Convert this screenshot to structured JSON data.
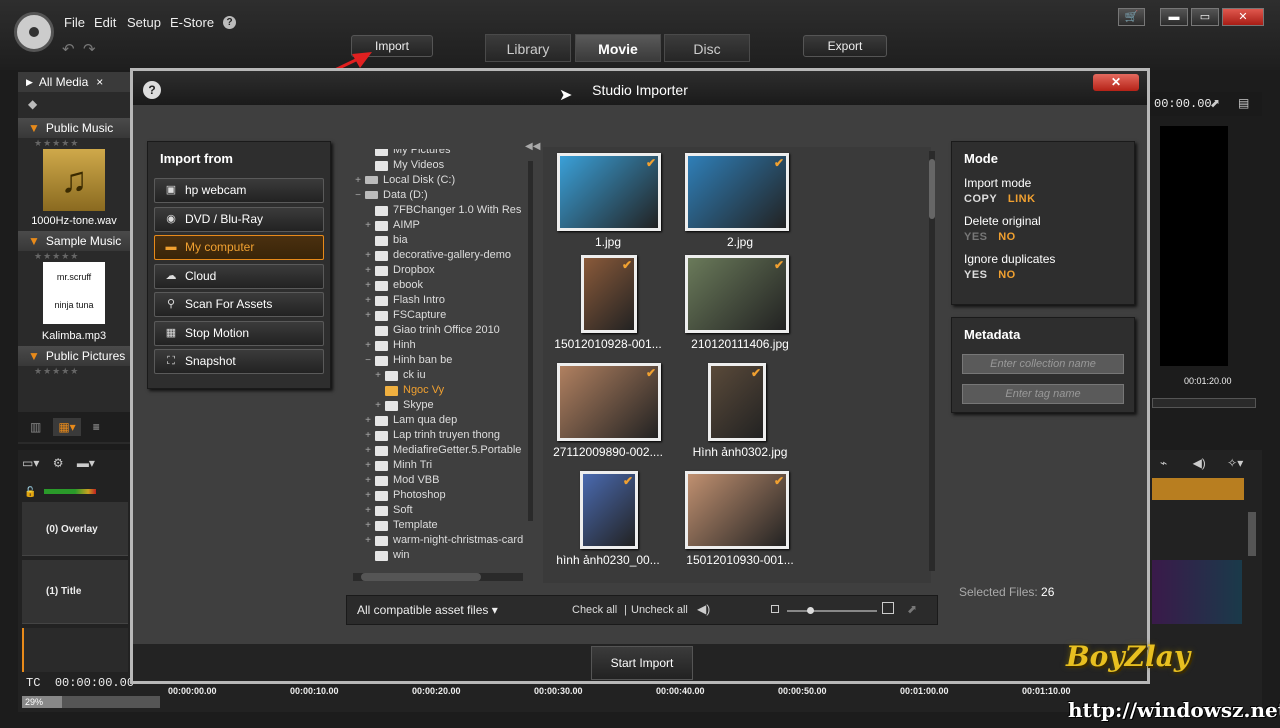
{
  "app": {
    "menu": [
      "File",
      "Edit",
      "Setup",
      "E-Store",
      "?"
    ],
    "import_label": "Import",
    "export_label": "Export",
    "tabs": [
      {
        "label": "Library",
        "active": false
      },
      {
        "label": "Movie",
        "active": true
      },
      {
        "label": "Disc",
        "active": false
      }
    ],
    "window_buttons": {
      "min": "▬",
      "max": "▭",
      "close": "✕",
      "cart": "🛒"
    }
  },
  "library": {
    "tab_label": "All Media",
    "tab_close": "×",
    "sections": [
      {
        "title": "Public Music",
        "item": "1000Hz-tone.wav"
      },
      {
        "title": "Sample Music",
        "item": "Kalimba.mp3",
        "art_lines": [
          "mr.scruff",
          "ninja tuna"
        ]
      },
      {
        "title": "Public Pictures",
        "item": ""
      }
    ]
  },
  "player": {
    "timecode": "00:00.00",
    "scrub_time": "00:01:20.00"
  },
  "timeline": {
    "tracks": [
      "(0) Overlay",
      "(1) Title"
    ],
    "tc_label": "TC",
    "tc_value": "00:00:00.00",
    "zoom": "29%",
    "ruler": [
      "00:00:00.00",
      "00:00:10.00",
      "00:00:20.00",
      "00:00:30.00",
      "00:00:40.00",
      "00:00:50.00",
      "00:01:00.00",
      "00:01:10.00"
    ]
  },
  "dialog": {
    "title": "Studio Importer",
    "help": "?",
    "close": "✕",
    "import_from": {
      "title": "Import from",
      "sources": [
        {
          "label": "hp webcam",
          "icon": "webcam-icon",
          "glyph": "▣",
          "selected": false
        },
        {
          "label": "DVD / Blu-Ray",
          "icon": "disc-icon",
          "glyph": "◉",
          "selected": false
        },
        {
          "label": "My computer",
          "icon": "folder-icon",
          "glyph": "▬",
          "selected": true
        },
        {
          "label": "Cloud",
          "icon": "cloud-icon",
          "glyph": "☁",
          "selected": false
        },
        {
          "label": "Scan For Assets",
          "icon": "magnifier-icon",
          "glyph": "⚲",
          "selected": false
        },
        {
          "label": "Stop Motion",
          "icon": "camera-icon",
          "glyph": "▦",
          "selected": false
        },
        {
          "label": "Snapshot",
          "icon": "snapshot-icon",
          "glyph": "⛶",
          "selected": false
        }
      ]
    },
    "tree": [
      {
        "label": "My Pictures",
        "indent": 1,
        "pm": "",
        "drive": false,
        "sel": false
      },
      {
        "label": "My Videos",
        "indent": 1,
        "pm": "",
        "drive": false,
        "sel": false
      },
      {
        "label": "Local Disk (C:)",
        "indent": 0,
        "pm": "+",
        "drive": true,
        "sel": false
      },
      {
        "label": "Data (D:)",
        "indent": 0,
        "pm": "−",
        "drive": true,
        "sel": false
      },
      {
        "label": "7FBChanger 1.0 With Res",
        "indent": 1,
        "pm": "",
        "drive": false,
        "sel": false
      },
      {
        "label": "AIMP",
        "indent": 1,
        "pm": "+",
        "drive": false,
        "sel": false
      },
      {
        "label": "bia",
        "indent": 1,
        "pm": "",
        "drive": false,
        "sel": false
      },
      {
        "label": "decorative-gallery-demo",
        "indent": 1,
        "pm": "+",
        "drive": false,
        "sel": false
      },
      {
        "label": "Dropbox",
        "indent": 1,
        "pm": "+",
        "drive": false,
        "sel": false
      },
      {
        "label": "ebook",
        "indent": 1,
        "pm": "+",
        "drive": false,
        "sel": false
      },
      {
        "label": "Flash Intro",
        "indent": 1,
        "pm": "+",
        "drive": false,
        "sel": false
      },
      {
        "label": "FSCapture",
        "indent": 1,
        "pm": "+",
        "drive": false,
        "sel": false
      },
      {
        "label": "Giao trinh Office 2010",
        "indent": 1,
        "pm": "",
        "drive": false,
        "sel": false
      },
      {
        "label": "Hinh",
        "indent": 1,
        "pm": "+",
        "drive": false,
        "sel": false
      },
      {
        "label": "Hinh ban be",
        "indent": 1,
        "pm": "−",
        "drive": false,
        "sel": false
      },
      {
        "label": "ck iu",
        "indent": 2,
        "pm": "+",
        "drive": false,
        "sel": false
      },
      {
        "label": "Ngoc Vy",
        "indent": 2,
        "pm": "",
        "drive": false,
        "sel": true
      },
      {
        "label": "Skype",
        "indent": 2,
        "pm": "+",
        "drive": false,
        "sel": false
      },
      {
        "label": "Lam qua dep",
        "indent": 1,
        "pm": "+",
        "drive": false,
        "sel": false
      },
      {
        "label": "Lap trinh truyen thong",
        "indent": 1,
        "pm": "+",
        "drive": false,
        "sel": false
      },
      {
        "label": "MediafireGetter.5.Portable",
        "indent": 1,
        "pm": "+",
        "drive": false,
        "sel": false
      },
      {
        "label": "Minh Tri",
        "indent": 1,
        "pm": "+",
        "drive": false,
        "sel": false
      },
      {
        "label": "Mod VBB",
        "indent": 1,
        "pm": "+",
        "drive": false,
        "sel": false
      },
      {
        "label": "Photoshop",
        "indent": 1,
        "pm": "+",
        "drive": false,
        "sel": false
      },
      {
        "label": "Soft",
        "indent": 1,
        "pm": "+",
        "drive": false,
        "sel": false
      },
      {
        "label": "Template",
        "indent": 1,
        "pm": "+",
        "drive": false,
        "sel": false
      },
      {
        "label": "warm-night-christmas-card",
        "indent": 1,
        "pm": "+",
        "drive": false,
        "sel": false
      },
      {
        "label": "win",
        "indent": 1,
        "pm": "",
        "drive": false,
        "sel": false
      }
    ],
    "files": [
      {
        "name": "1.jpg",
        "bg": "#3aa0d8"
      },
      {
        "name": "2.jpg",
        "bg": "#2f7fb8"
      },
      {
        "name": "15012010928-001...",
        "bg": "#8a5a3a"
      },
      {
        "name": "210120111406.jpg",
        "bg": "#6a7a5a"
      },
      {
        "name": "27112009890-002....",
        "bg": "#b08060"
      },
      {
        "name": "Hình ảnh0302.jpg",
        "bg": "#5a4a3a"
      },
      {
        "name": "hình ảnh0230_00...",
        "bg": "#4a6ab0"
      },
      {
        "name": "15012010930-001...",
        "bg": "#c09070"
      }
    ],
    "filter_label": "All compatible asset files",
    "check_all": "Check all",
    "separator": "|",
    "uncheck_all": "Uncheck all",
    "mode": {
      "title": "Mode",
      "import_mode_label": "Import mode",
      "import_mode": {
        "a": "COPY",
        "b": "LINK"
      },
      "delete_label": "Delete original",
      "delete": {
        "a": "YES",
        "b": "NO"
      },
      "ignore_label": "Ignore duplicates",
      "ignore": {
        "a": "YES",
        "b": "NO"
      }
    },
    "metadata": {
      "title": "Metadata",
      "collection_placeholder": "Enter collection name",
      "tag_placeholder": "Enter tag name"
    },
    "selected_files_label": "Selected Files:",
    "selected_files_count": "26",
    "start_import": "Start Import"
  },
  "watermark": {
    "text": "http://windowsz.net",
    "logo_text": "BoyZlay"
  },
  "colors": {
    "accent": "#e88a1a",
    "close_red": "#c4281c",
    "arrow": "#e02020"
  }
}
